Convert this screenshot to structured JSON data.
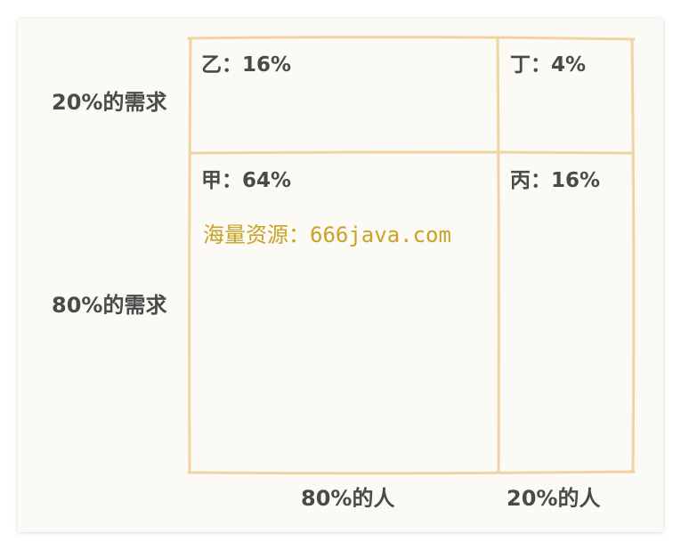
{
  "diagram": {
    "row_labels": {
      "top": "20%的需求",
      "bottom": "80%的需求"
    },
    "column_labels": {
      "left": "80%的人",
      "right": "20%的人"
    },
    "cells": {
      "top_left": "乙：16%",
      "top_right": "丁：4%",
      "bottom_left": "甲：64%",
      "bottom_right": "丙：16%"
    },
    "watermark": "海量资源：666java.com",
    "line_color": "#efd3a0",
    "background_color": "#fbfaf4",
    "text_color": "#4a4a4a",
    "watermark_color": "#c9a227"
  }
}
